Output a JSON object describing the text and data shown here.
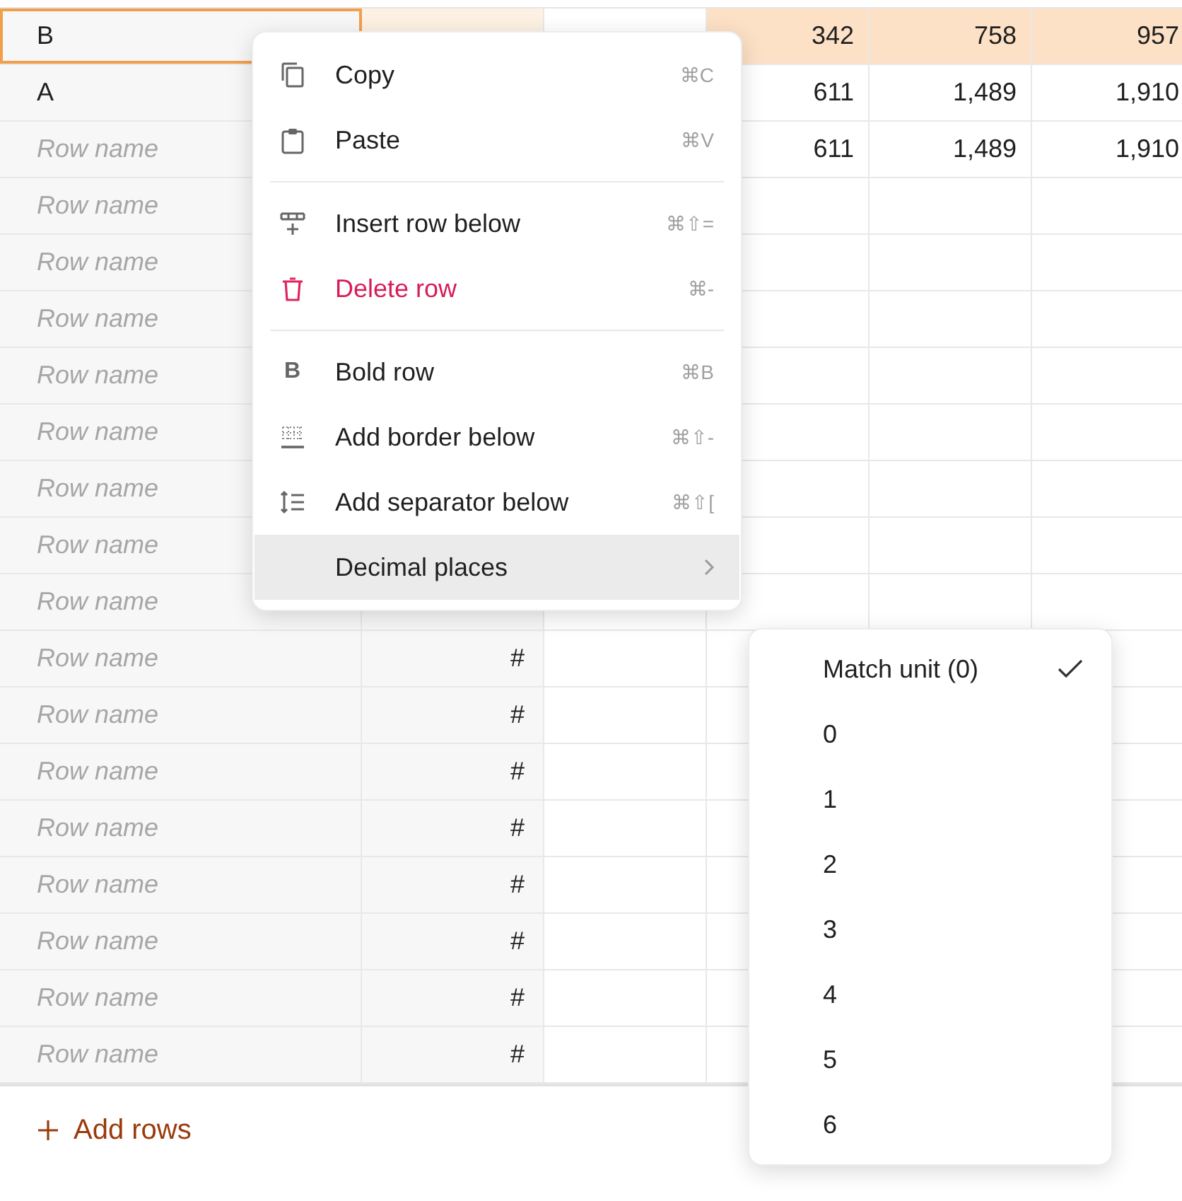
{
  "table": {
    "rows": [
      {
        "name": "B",
        "selected": true,
        "unit_highlighted": true,
        "cells": [
          {
            "text": "342",
            "highlighted": true
          },
          {
            "text": "758",
            "highlighted": true
          },
          {
            "text": "957",
            "highlighted": true
          }
        ]
      },
      {
        "name": "A",
        "selected": false,
        "cells": [
          {
            "text": "611",
            "highlighted": false
          },
          {
            "text": "1,489",
            "highlighted": false
          },
          {
            "text": "1,910",
            "highlighted": false
          }
        ]
      },
      {
        "placeholder": "Row name",
        "selected": false,
        "cells": [
          {
            "text": "611",
            "highlighted": false
          },
          {
            "text": "1,489",
            "highlighted": false
          },
          {
            "text": "1,910",
            "highlighted": false
          }
        ]
      },
      {
        "placeholder": "Row name",
        "selected": false
      },
      {
        "placeholder": "Row name",
        "selected": false
      },
      {
        "placeholder": "Row name",
        "selected": false
      },
      {
        "placeholder": "Row name",
        "selected": false
      },
      {
        "placeholder": "Row name",
        "selected": false
      },
      {
        "placeholder": "Row name",
        "selected": false
      },
      {
        "placeholder": "Row name",
        "selected": false
      },
      {
        "placeholder": "Row name",
        "selected": false
      },
      {
        "placeholder": "Row name",
        "selected": false,
        "unit": "#"
      },
      {
        "placeholder": "Row name",
        "selected": false,
        "unit": "#"
      },
      {
        "placeholder": "Row name",
        "selected": false,
        "unit": "#"
      },
      {
        "placeholder": "Row name",
        "selected": false,
        "unit": "#"
      },
      {
        "placeholder": "Row name",
        "selected": false,
        "unit": "#"
      },
      {
        "placeholder": "Row name",
        "selected": false,
        "unit": "#"
      },
      {
        "placeholder": "Row name",
        "selected": false,
        "unit": "#"
      },
      {
        "placeholder": "Row name",
        "selected": false,
        "unit": "#"
      }
    ]
  },
  "add_rows": {
    "label": "Add rows"
  },
  "context_menu": {
    "items": [
      {
        "kind": "item",
        "label": "Copy",
        "shortcut": "⌘C",
        "danger": false,
        "highlighted": false
      },
      {
        "kind": "item",
        "label": "Paste",
        "shortcut": "⌘V",
        "danger": false,
        "highlighted": false
      },
      {
        "kind": "separator"
      },
      {
        "kind": "item",
        "label": "Insert row below",
        "shortcut": "⌘⇧=",
        "danger": false,
        "highlighted": false
      },
      {
        "kind": "item",
        "label": "Delete row",
        "shortcut": "⌘-",
        "danger": true,
        "highlighted": false
      },
      {
        "kind": "separator"
      },
      {
        "kind": "item",
        "label": "Bold row",
        "glyph": "B",
        "shortcut": "⌘B",
        "danger": false,
        "highlighted": false
      },
      {
        "kind": "item",
        "label": "Add border below",
        "shortcut": "⌘⇧-",
        "danger": false,
        "highlighted": false
      },
      {
        "kind": "item",
        "label": "Add separator below",
        "shortcut": "⌘⇧[",
        "danger": false,
        "highlighted": false
      },
      {
        "kind": "submenu",
        "label": "Decimal places",
        "danger": false,
        "highlighted": true
      }
    ]
  },
  "submenu": {
    "options": [
      {
        "label": "Match unit (0)",
        "selected": true
      },
      {
        "label": "0",
        "selected": false
      },
      {
        "label": "1",
        "selected": false
      },
      {
        "label": "2",
        "selected": false
      },
      {
        "label": "3",
        "selected": false
      },
      {
        "label": "4",
        "selected": false
      },
      {
        "label": "5",
        "selected": false
      },
      {
        "label": "6",
        "selected": false
      }
    ]
  }
}
